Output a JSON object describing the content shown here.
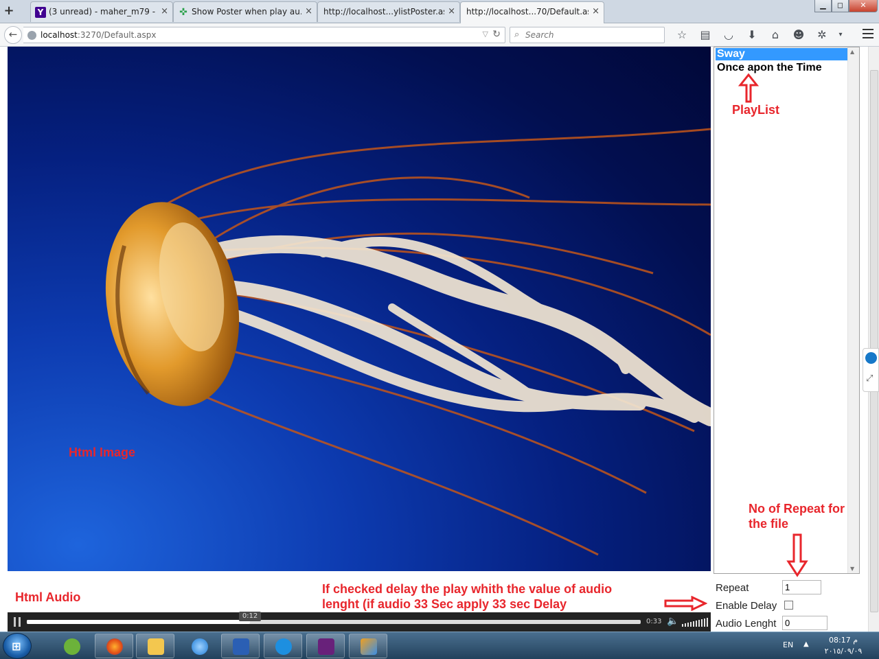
{
  "browser": {
    "tabs": [
      {
        "title": "(3 unread) - maher_m79 - ...",
        "favicon": "yahoo-icon",
        "color": "#400090"
      },
      {
        "title": "Show Poster when play au...",
        "favicon": "stackexchange-icon",
        "color": "#2aa14a"
      },
      {
        "title": "http://localhost...ylistPoster.aspx",
        "favicon": "none"
      },
      {
        "title": "http://localhost...70/Default.aspx",
        "favicon": "none",
        "active": true
      }
    ],
    "new_tab": "+",
    "tab_close": "×",
    "window_controls": {
      "minimize": "▁",
      "maximize": "◻",
      "close": "✕"
    },
    "url_host": "localhost",
    "url_path": ":3270/Default.aspx",
    "search_placeholder": "Search",
    "toolbar_icons": [
      "bookmark-star-icon",
      "reading-list-icon",
      "pocket-icon",
      "download-icon",
      "home-icon",
      "chat-icon",
      "extension-icon",
      "dropdown-icon"
    ]
  },
  "page": {
    "annotations": {
      "html_image": "Html Image",
      "playlist": "PlayList",
      "repeat_note": "No of Repeat for the file",
      "html_audio": "Html Audio",
      "delay_note_line1": "If checked delay the play whith the value of audio",
      "delay_note_line2": "lenght (if audio  33 Sec apply 33 sec Delay",
      "accent_color": "#e8262c"
    },
    "playlist": {
      "items": [
        "Sway",
        "Once apon the Time"
      ],
      "selected_index": 0,
      "selection_color": "#3399ff"
    },
    "form": {
      "repeat_label": "Repeat",
      "repeat_value": "1",
      "enable_delay_label": "Enable Delay",
      "enable_delay_checked": false,
      "audio_length_label": "Audio Lenght",
      "audio_length_value": "0"
    },
    "audio": {
      "current_time": "0:12",
      "duration": "0:33",
      "progress_fraction": 0.3636,
      "volume_level": 1.0
    }
  },
  "taskbar": {
    "apps": [
      "frog-app-icon",
      "firefox-icon",
      "file-explorer-icon",
      "internet-explorer-icon",
      "word-icon",
      "teamviewer-icon",
      "visual-studio-icon",
      "paint-9-icon"
    ],
    "language": "EN",
    "time": "08:17 م",
    "date": "٢٠١٥/٠٩/٠٩"
  }
}
